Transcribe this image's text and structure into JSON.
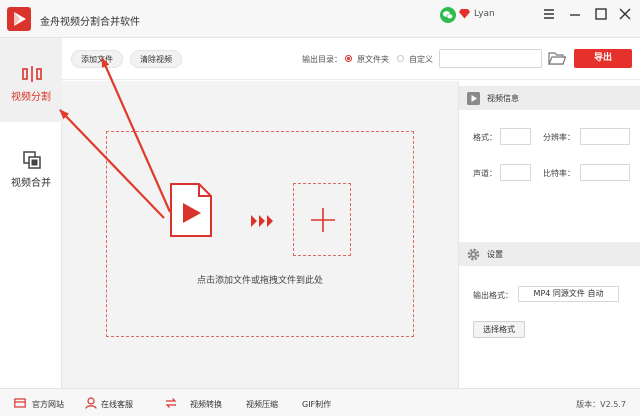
{
  "app": {
    "title": "金舟视频分割合并软件",
    "username": "Lyan",
    "brand_color": "#d9342b"
  },
  "icons": {
    "logo": "play-logo-icon",
    "wechat": "wechat-icon",
    "vip": "diamond-icon",
    "menu": "hamburger-menu-icon",
    "minimize": "minimize-icon",
    "maximize": "maximize-icon",
    "close": "close-icon",
    "split": "split-icon",
    "merge": "merge-icon",
    "folder": "folder-icon",
    "home": "home-icon",
    "service": "headset-icon",
    "convert": "convert-icon"
  },
  "sidebar": {
    "items": [
      {
        "label": "视频分割",
        "active": true
      },
      {
        "label": "视频合并",
        "active": false
      }
    ]
  },
  "toolbar": {
    "add_file": "添加文件",
    "clear_video": "清除视频",
    "output_dir_label": "输出目录：",
    "option_source": "原文件夹",
    "option_custom": "自定义",
    "output_path": "",
    "export_label": "导出"
  },
  "main": {
    "drop_hint": "点击添加文件或拖拽文件到此处"
  },
  "video_info": {
    "title": "视频信息",
    "format_label": "格式：",
    "resolution_label": "分辨率：",
    "channel_label": "声道：",
    "bitrate_label": "比特率：",
    "format_value": "",
    "resolution_value": "",
    "channel_value": "",
    "bitrate_value": ""
  },
  "settings": {
    "title": "设置",
    "output_format_label": "输出格式：",
    "output_format_value": "MP4 同源文件 自动",
    "choose_format": "选择格式"
  },
  "statusbar": {
    "website": "官方网站",
    "service": "在线客服",
    "convert": "视频转换",
    "compress": "视频压缩",
    "gif": "GIF制作",
    "version": "版本：V2.5.7"
  }
}
